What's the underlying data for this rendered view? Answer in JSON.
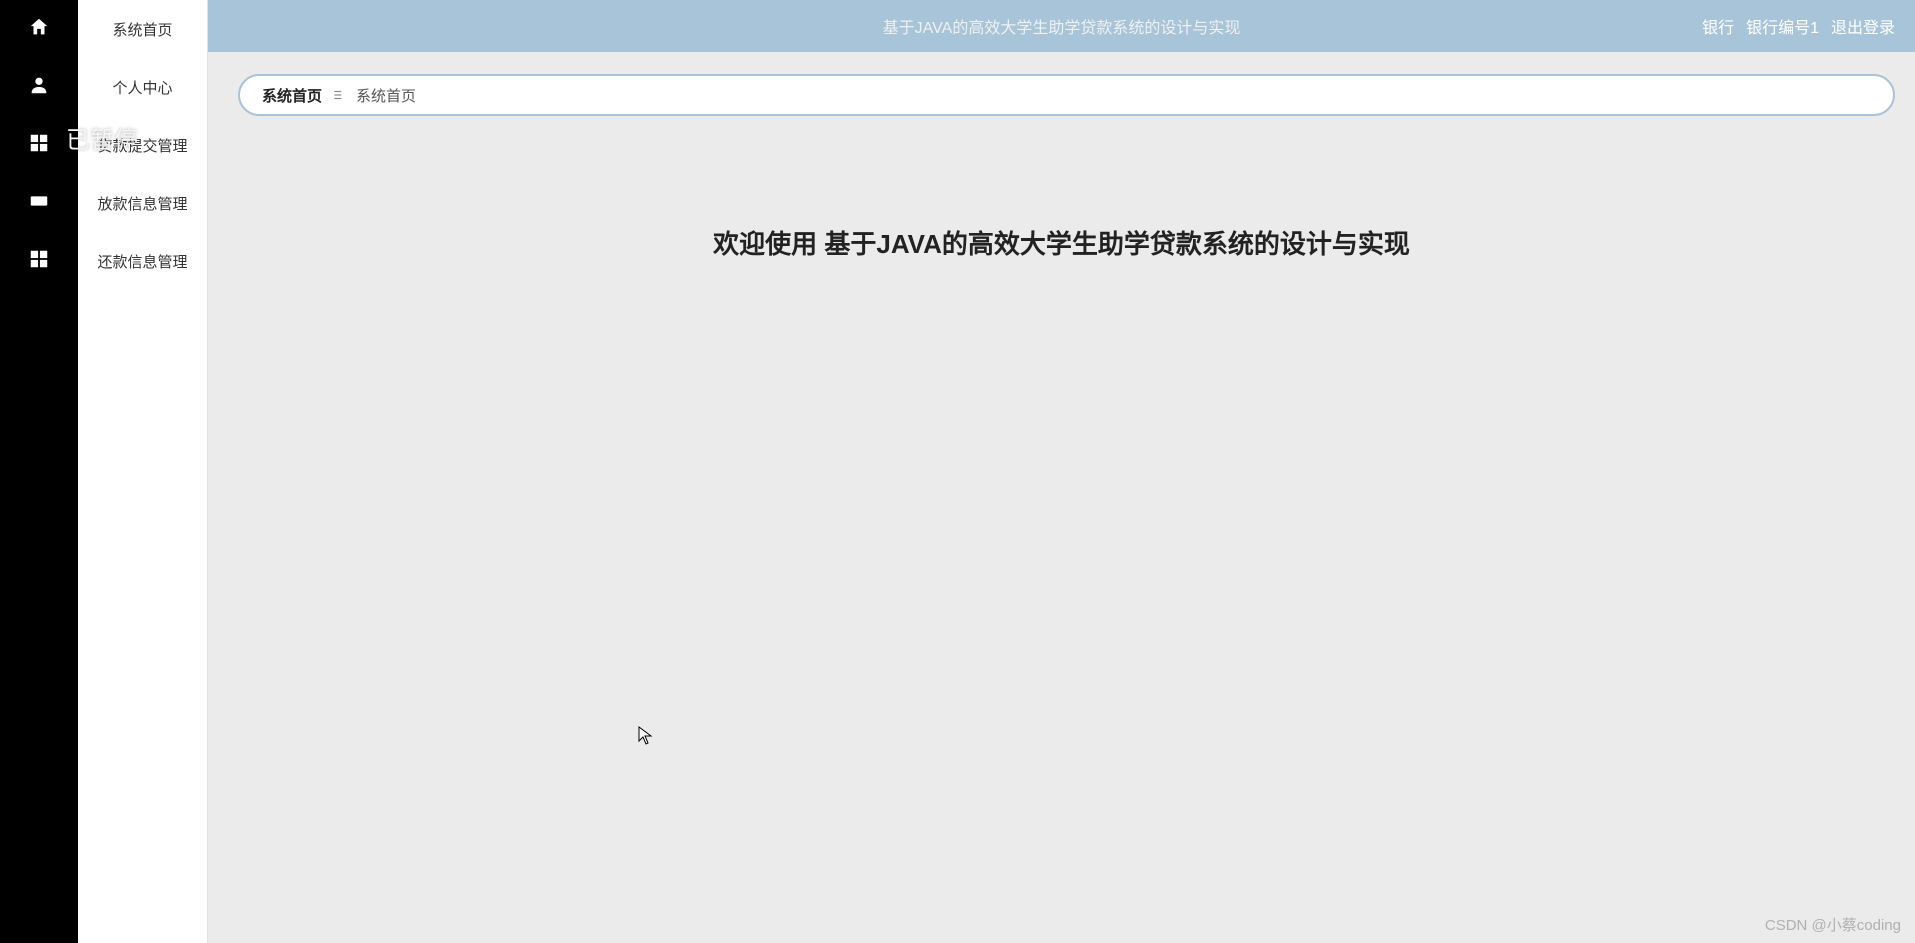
{
  "header": {
    "title": "基于JAVA的高效大学生助学贷款系统的设计与实现",
    "user_role": "银行",
    "user_id": "银行编号1",
    "logout_label": "退出登录"
  },
  "sidebar": {
    "items": [
      {
        "icon": "home-icon",
        "label": "系统首页"
      },
      {
        "icon": "person-icon",
        "label": "个人中心"
      },
      {
        "icon": "grid-icon",
        "label": "贷款提交管理"
      },
      {
        "icon": "ticket-icon",
        "label": "放款信息管理"
      },
      {
        "icon": "grid-icon",
        "label": "还款信息管理"
      }
    ]
  },
  "breadcrumb": {
    "root": "系统首页",
    "current": "系统首页"
  },
  "main": {
    "welcome_prefix": "欢迎使用 ",
    "welcome_title": "基于JAVA的高效大学生助学贷款系统的设计与实现"
  },
  "overlay": {
    "pause_text": "已暂停"
  },
  "watermark": "CSDN @小蔡coding"
}
